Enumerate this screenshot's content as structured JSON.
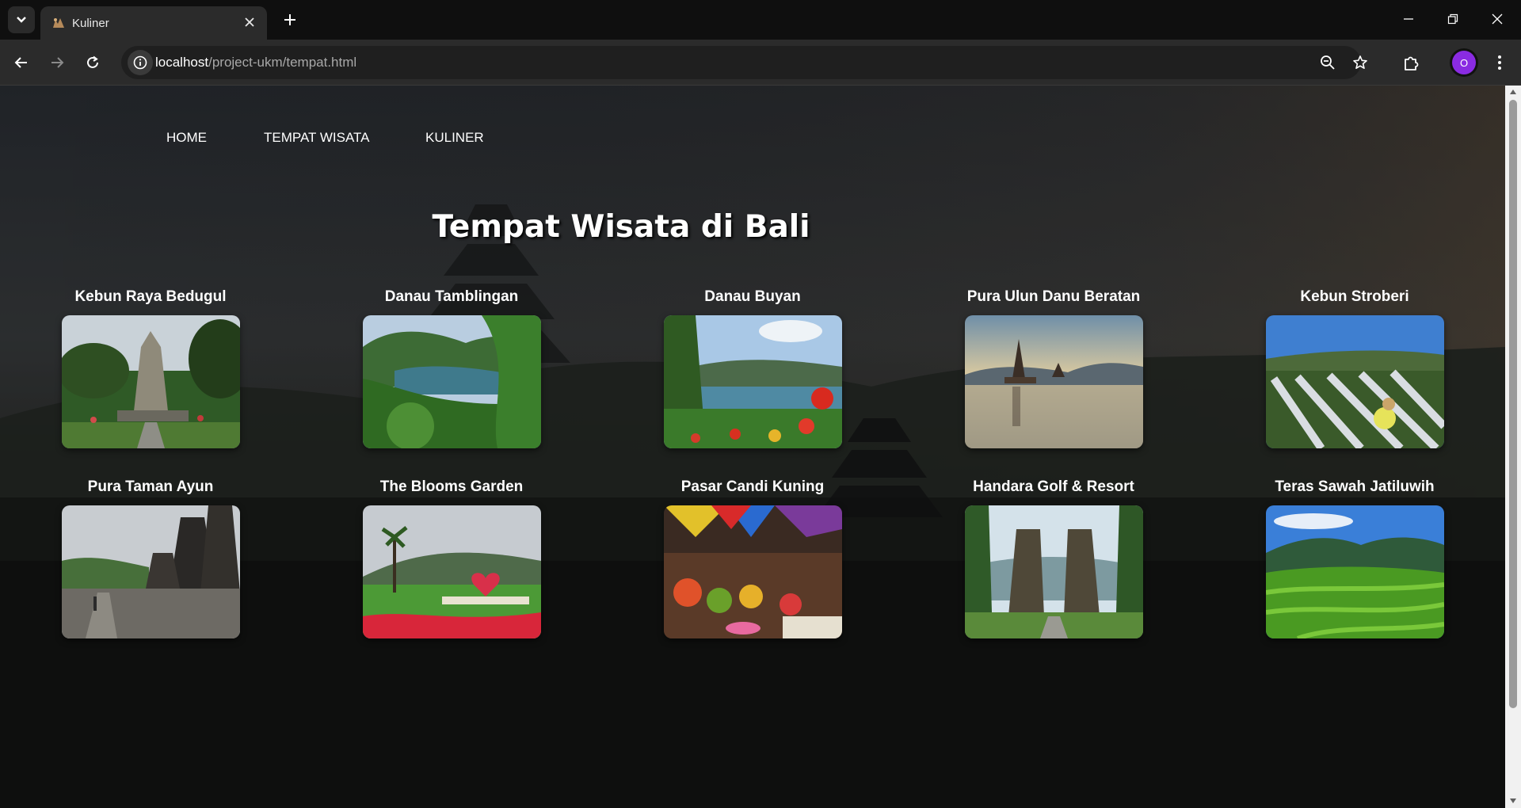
{
  "browser": {
    "tab_title": "Kuliner",
    "url_host": "localhost",
    "url_path": "/project-ukm/tempat.html",
    "profile_initial": "O",
    "profile_color": "#8a2be2"
  },
  "nav": {
    "items": [
      {
        "label": "HOME"
      },
      {
        "label": "TEMPAT WISATA"
      },
      {
        "label": "KULINER"
      }
    ]
  },
  "page": {
    "title": "Tempat Wisata di Bali"
  },
  "places": [
    {
      "name": "Kebun Raya Bedugul",
      "scene": "garden-statue"
    },
    {
      "name": "Danau Tamblingan",
      "scene": "lake-forest"
    },
    {
      "name": "Danau Buyan",
      "scene": "lake-flowers"
    },
    {
      "name": "Pura Ulun Danu Beratan",
      "scene": "lake-temple"
    },
    {
      "name": "Kebun Stroberi",
      "scene": "strawberry-farm"
    },
    {
      "name": "Pura Taman Ayun",
      "scene": "temple-towers"
    },
    {
      "name": "The Blooms Garden",
      "scene": "flower-garden"
    },
    {
      "name": "Pasar Candi Kuning",
      "scene": "market"
    },
    {
      "name": "Handara Golf & Resort",
      "scene": "split-gate"
    },
    {
      "name": "Teras Sawah Jatiluwih",
      "scene": "rice-terraces"
    }
  ]
}
